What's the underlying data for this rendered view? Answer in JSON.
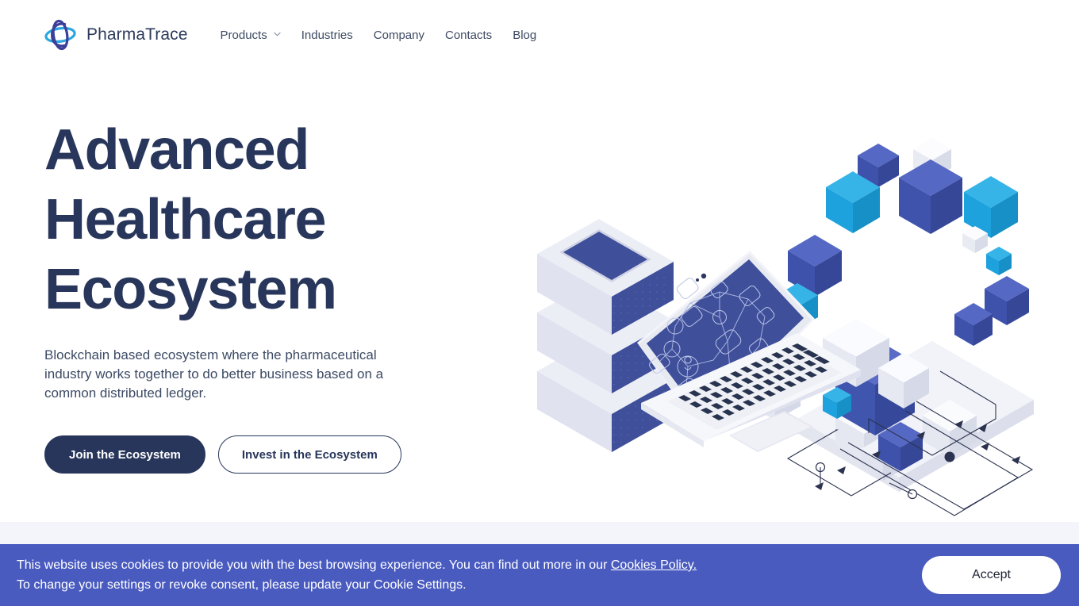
{
  "brand": {
    "name": "PharmaTrace",
    "logo_icon": "pharmatrace-atom-logo",
    "logo_color_dark": "#3b3f98",
    "logo_color_light": "#2ba6e0"
  },
  "nav": {
    "items": [
      {
        "label": "Products",
        "has_dropdown": true,
        "icon": "chevron-down-icon"
      },
      {
        "label": "Industries",
        "has_dropdown": false
      },
      {
        "label": "Company",
        "has_dropdown": false
      },
      {
        "label": "Contacts",
        "has_dropdown": false
      },
      {
        "label": "Blog",
        "has_dropdown": false
      }
    ]
  },
  "hero": {
    "headline_line1": "Advanced",
    "headline_line2": "Healthcare",
    "headline_line3": "Ecosystem",
    "headline_color": "#27365a",
    "subcopy": "Blockchain based ecosystem where the pharmaceutical industry works together to do better business based on a common distributed ledger.",
    "primary_cta": "Join the Ecosystem",
    "secondary_cta": "Invest in the Ecosystem",
    "illustration_name": "isometric-blockchain-servers-laptop-illustration",
    "illustration_colors": {
      "server_body": "#3d4d96",
      "server_light": "#e9eaf3",
      "cube_blue": "#4459b8",
      "cube_cyan": "#1ba6e2",
      "cube_white": "#eceef6",
      "screen": "#3c4c96",
      "keys": "#27334f"
    }
  },
  "cookie_banner": {
    "background": "#4a5bc0",
    "line1_before_link": "This website uses cookies to provide you with the best browsing experience. You can find out more in our ",
    "link_label": "Cookies Policy.",
    "line2": "To change your settings or revoke consent, please update your Cookie Settings.",
    "accept_label": "Accept"
  }
}
